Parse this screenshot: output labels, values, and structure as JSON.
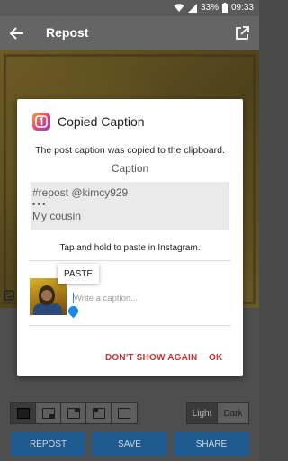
{
  "status_bar": {
    "battery": "33%",
    "time": "09:33"
  },
  "app_bar": {
    "title": "Repost"
  },
  "dialog": {
    "title": "Copied Caption",
    "message": "The post caption was copied to the clipboard.",
    "caption_label": "Caption",
    "caption_lines": [
      "#repost @kimcy929",
      "• • •",
      "My cousin"
    ],
    "hint": "Tap and hold to paste in Instagram.",
    "paste_label": "PASTE",
    "caption_placeholder": "Write a caption...",
    "dont_show_label": "DON'T SHOW AGAIN",
    "ok_label": "OK"
  },
  "theme_toggle": {
    "light": "Light",
    "dark": "Dark",
    "selected": "Light"
  },
  "actions": {
    "repost": "REPOST",
    "save": "SAVE",
    "share": "SHARE"
  },
  "colors": {
    "accent": "#d32f2f",
    "action_button": "#1e5a8e",
    "icon_gradient": [
      "#f0a33a",
      "#e2437a",
      "#9b3cc6"
    ]
  }
}
